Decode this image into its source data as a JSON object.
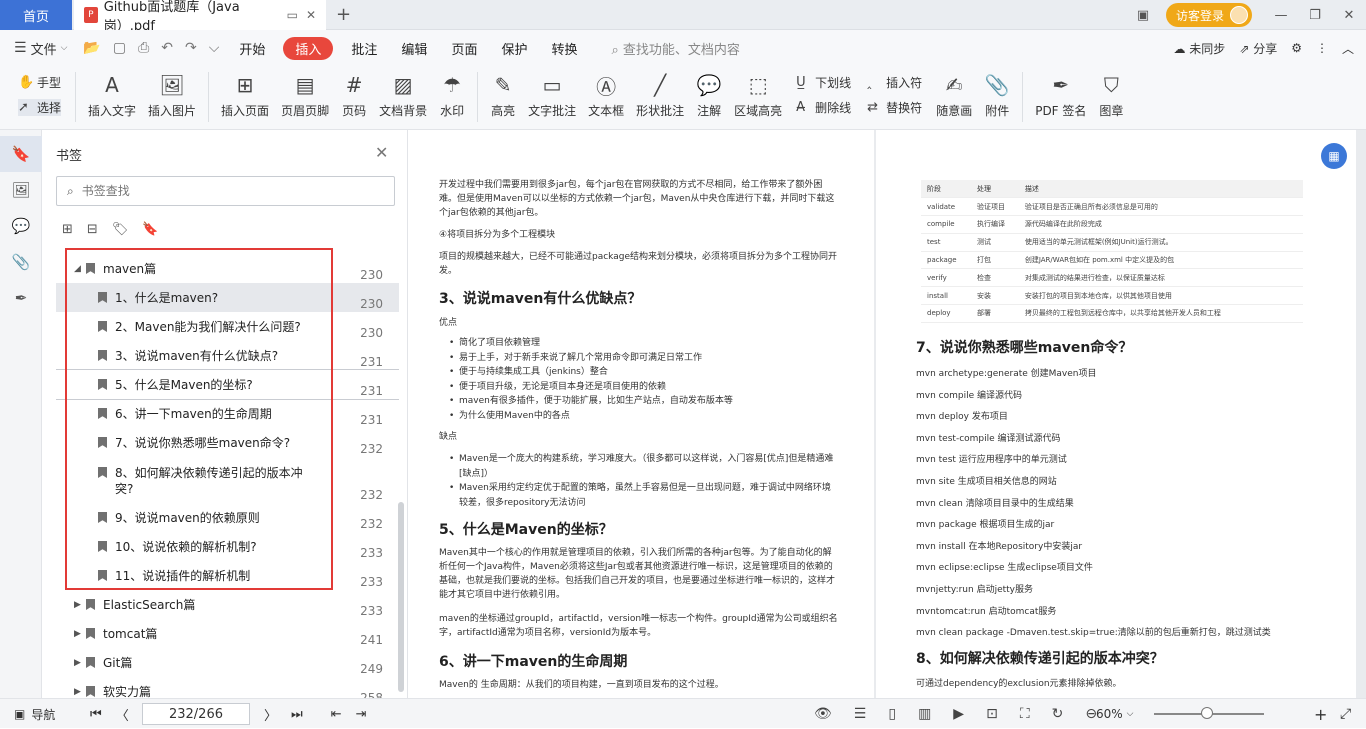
{
  "titlebar": {
    "home": "首页",
    "doc_tab": "Github面试题库（Java岗）.pdf",
    "new_tab": "+",
    "login": "访客登录"
  },
  "menubar": {
    "file": "文件",
    "items": [
      "开始",
      "插入",
      "批注",
      "编辑",
      "页面",
      "保护",
      "转换"
    ],
    "active_index": 1,
    "search": "查找功能、文档内容",
    "sync": "未同步",
    "share": "分享"
  },
  "ribbon": {
    "hand": "手型",
    "select": "选择",
    "insert_text": "插入文字",
    "insert_image": "插入图片",
    "insert_page": "插入页面",
    "header_footer": "页眉页脚",
    "page_number": "页码",
    "doc_background": "文档背景",
    "watermark": "水印",
    "highlight": "高亮",
    "text_comment": "文字批注",
    "textbox": "文本框",
    "shape_comment": "形状批注",
    "annotation": "注解",
    "area_highlight": "区域高亮",
    "underline": "下划线",
    "strikethrough": "删除线",
    "insert_symbol": "插入符",
    "replace_symbol": "替换符",
    "freehand": "随意画",
    "attachment": "附件",
    "pdf_sign": "PDF 签名",
    "stamp": "图章"
  },
  "bookmarks": {
    "title": "书签",
    "search_placeholder": "书签查找",
    "items": [
      {
        "label": "maven篇",
        "page": "230"
      },
      {
        "label": "1、什么是maven?",
        "page": "230"
      },
      {
        "label": "2、Maven能为我们解决什么问题?",
        "page": "230"
      },
      {
        "label": "3、说说maven有什么优缺点?",
        "page": "231"
      },
      {
        "label": "5、什么是Maven的坐标?",
        "page": "231"
      },
      {
        "label": "6、讲一下maven的生命周期",
        "page": "231"
      },
      {
        "label": "7、说说你熟悉哪些maven命令?",
        "page": "232"
      },
      {
        "label": "8、如何解决依赖传递引起的版本冲突?",
        "page": "232"
      },
      {
        "label": "9、说说maven的依赖原则",
        "page": "232"
      },
      {
        "label": "10、说说依赖的解析机制?",
        "page": "233"
      },
      {
        "label": "11、说说插件的解析机制",
        "page": "233"
      },
      {
        "label": "ElasticSearch篇",
        "page": "233"
      },
      {
        "label": "tomcat篇",
        "page": "241"
      },
      {
        "label": "Git篇",
        "page": "249"
      },
      {
        "label": "软实力篇",
        "page": "258"
      }
    ]
  },
  "page1": {
    "p1": "开发过程中我们需要用到很多jar包，每个jar包在官网获取的方式不尽相同，给工作带来了额外困难。但是使用Maven可以以坐标的方式依赖一个jar包，Maven从中央仓库进行下载，并同时下载这个jar包依赖的其他jar包。",
    "p2": "④将项目拆分为多个工程模块",
    "p3": "项目的规模越来越大，已经不可能通过package结构来划分模块，必须将项目拆分为多个工程协同开发。",
    "h_cons": "3、说说maven有什么优缺点？",
    "pros_label": "优点",
    "pros": [
      "简化了项目依赖管理",
      "易于上手，对于新手来说了解几个常用命令即可满足日常工作",
      "便于与持续集成工具（jenkins）整合",
      "便于项目升级，无论是项目本身还是项目使用的依赖",
      "maven有很多插件，便于功能扩展，比如生产站点，自动发布版本等",
      "为什么使用Maven中的各点"
    ],
    "cons_label": "缺点",
    "cons": [
      "Maven是一个庞大的构建系统，学习难度大。（很多都可以这样说，入门容易[优点]但是精通难[缺点]）",
      "Maven采用约定约定优于配置的策略，虽然上手容易但是一旦出现问题，难于调试中网络环境较差，很多repository无法访问"
    ],
    "h_coord": "5、什么是Maven的坐标？",
    "coord1": "Maven其中一个核心的作用就是管理项目的依赖，引入我们所需的各种jar包等。为了能自动化的解析任何一个Java构件，Maven必须将这些Jar包或者其他资源进行唯一标识，这是管理项目的依赖的基础，也就是我们要说的坐标。包括我们自己开发的项目，也是要通过坐标进行唯一标识的，这样才能才其它项目中进行依赖引用。",
    "coord2": "maven的坐标通过groupId，artifactId，version唯一标志一个构件。groupId通常为公司或组织名字，artifactId通常为项目名称，versionId为版本号。",
    "h_life": "6、讲一下maven的生命周期",
    "life1": "Maven的 生命周期：从我们的项目构建，一直到项目发布的这个过程。"
  },
  "page2": {
    "table_headers": [
      "阶段",
      "处理",
      "描述"
    ],
    "table_rows": [
      [
        "validate",
        "验证项目",
        "验证项目是否正确且所有必须信息是可用的"
      ],
      [
        "compile",
        "执行编译",
        "源代码编译在此阶段完成"
      ],
      [
        "test",
        "测试",
        "使用适当的单元测试框架(例如JUnit)运行测试。"
      ],
      [
        "package",
        "打包",
        "创建JAR/WAR包如在 pom.xml 中定义提及的包"
      ],
      [
        "verify",
        "检查",
        "对集成测试的结果进行检查，以保证质量达标"
      ],
      [
        "install",
        "安装",
        "安装打包的项目到本地仓库，以供其他项目使用"
      ],
      [
        "deploy",
        "部署",
        "拷贝最终的工程包到远程仓库中，以共享给其他开发人员和工程"
      ]
    ],
    "h_cmd": "7、说说你熟悉哪些maven命令？",
    "commands": [
      "mvn archetype:generate 创建Maven项目",
      "mvn compile 编译源代码",
      "mvn deploy 发布项目",
      "mvn test-compile 编译测试源代码",
      "mvn test 运行应用程序中的单元测试",
      "mvn site 生成项目相关信息的网站",
      "mvn clean 清除项目目录中的生成结果",
      "mvn package 根据项目生成的jar",
      "mvn install 在本地Repository中安装jar",
      "mvn eclipse:eclipse 生成eclipse项目文件",
      "mvnjetty:run 启动jetty服务",
      "mvntomcat:run 启动tomcat服务",
      "mvn clean package -Dmaven.test.skip=true:清除以前的包后重新打包，跳过测试类"
    ],
    "h_conflict": "8、如何解决依赖传递引起的版本冲突？",
    "conflict1": "可通过dependency的exclusion元素排除掉依赖。"
  },
  "status": {
    "nav": "导航",
    "page": "232/266",
    "zoom": "60%"
  }
}
